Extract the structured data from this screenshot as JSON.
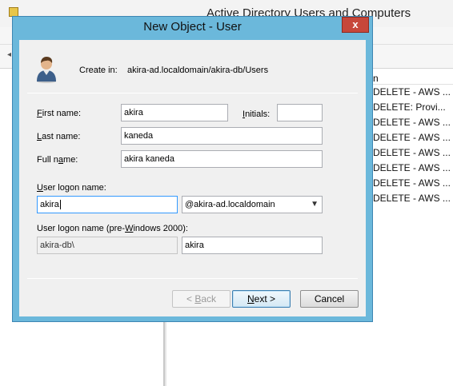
{
  "background_window": {
    "title": "Active Directory Users and Computers",
    "list_header": "n",
    "list_items": [
      "DELETE - AWS ...",
      "DELETE:  Provi...",
      "DELETE - AWS ...",
      "DELETE - AWS ...",
      "DELETE - AWS ...",
      "DELETE - AWS ...",
      "DELETE - AWS ...",
      "DELETE - AWS ..."
    ]
  },
  "dialog": {
    "title": "New Object - User",
    "close_glyph": "x",
    "create_in_label": "Create in:",
    "create_in_path": "akira-ad.localdomain/akira-db/Users",
    "first_name": {
      "label_ul": "F",
      "label_rest": "irst name:",
      "value": "akira"
    },
    "initials": {
      "label_ul": "I",
      "label_rest": "nitials:",
      "value": ""
    },
    "last_name": {
      "label_ul": "L",
      "label_rest": "ast name:",
      "value": "kaneda"
    },
    "full_name": {
      "label_pre": "Full n",
      "label_ul": "a",
      "label_rest": "me:",
      "value": "akira kaneda"
    },
    "logon_name": {
      "label_ul": "U",
      "label_rest": "ser logon name:",
      "value": "akira"
    },
    "domain_select": {
      "selected": "@akira-ad.localdomain"
    },
    "pre2000": {
      "label_pre": "User logon name (pre-",
      "label_ul": "W",
      "label_rest": "indows 2000):",
      "domain_prefix": "akira-db\\",
      "value": "akira"
    },
    "buttons": {
      "back": {
        "prefix": "< ",
        "ul": "B",
        "rest": "ack"
      },
      "next": {
        "ul": "N",
        "rest": "ext >"
      },
      "cancel": "Cancel"
    }
  }
}
